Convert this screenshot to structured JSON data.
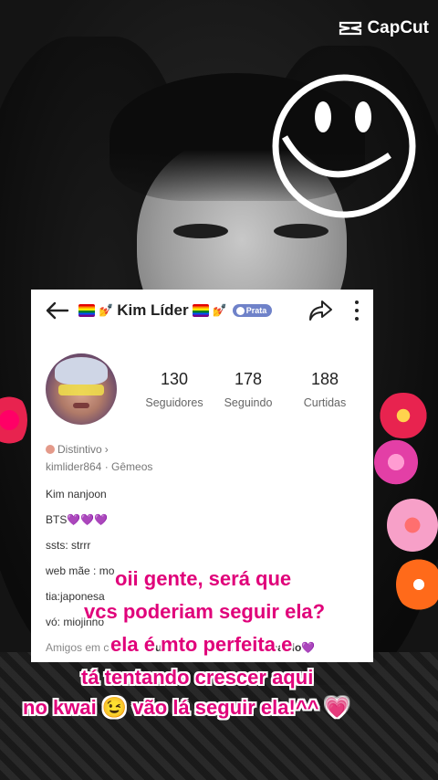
{
  "watermark": {
    "brand": "CapCut"
  },
  "profile": {
    "title": "Kim Líder",
    "rank_badge": "Prata",
    "stats": [
      {
        "value": "130",
        "label": "Seguidores"
      },
      {
        "value": "178",
        "label": "Seguindo"
      },
      {
        "value": "188",
        "label": "Curtidas"
      }
    ],
    "distintivo_label": "Distintivo",
    "username_line": "kimlider864 · Gêmeos",
    "bio_lines": [
      "Kim nanjoon",
      "BTS💜💜💜",
      "ssts: strrr",
      "web mãe : mo",
      "tia:japonesa",
      "vó: miojinho"
    ],
    "mutual_label": "Amigos em comum",
    "mutual_names": "Bruninzor",
    "mutual_names_2": "TiTio Bernardo💜"
  },
  "caption": {
    "lines": [
      "oii gente, será que",
      "vcs poderiam seguir ela?",
      "ela é mto perfeita e",
      "tá tentando crescer aqui",
      "no kwai 😉 vão lá seguir ela!^^ 💗"
    ]
  },
  "colors": {
    "caption": "#e0007a",
    "badge": "#6f82c9",
    "heart": "#8a2be2"
  }
}
